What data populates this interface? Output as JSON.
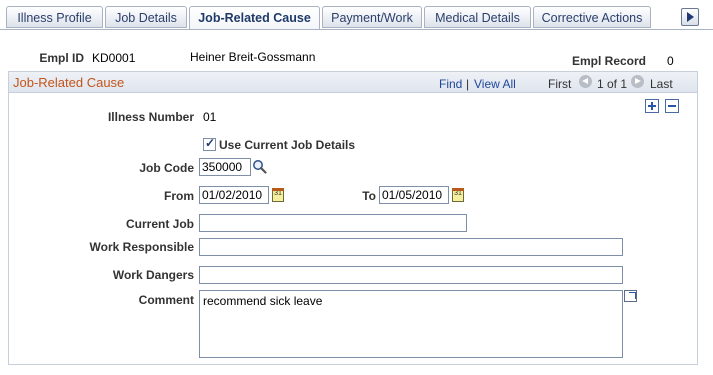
{
  "tabs": [
    {
      "label": "Illness Profile"
    },
    {
      "label": "Job Details"
    },
    {
      "label": "Job-Related Cause"
    },
    {
      "label": "Payment/Work"
    },
    {
      "label": "Medical Details"
    },
    {
      "label": "Corrective Actions"
    }
  ],
  "active_tab": "Job-Related Cause",
  "header": {
    "empl_id_label": "Empl ID",
    "empl_id": "KD0001",
    "empl_name": "Heiner Breit-Gossmann",
    "empl_record_label": "Empl Record",
    "empl_record": "0"
  },
  "grid": {
    "title": "Job-Related Cause",
    "find": "Find",
    "separator": "|",
    "view_all": "View All",
    "first": "First",
    "page_info": "1 of 1",
    "last": "Last"
  },
  "form": {
    "illness_number_label": "Illness Number",
    "illness_number": "01",
    "use_current_label": "Use Current Job Details",
    "use_current_checked": true,
    "job_code_label": "Job Code",
    "job_code": "350000",
    "from_label": "From",
    "from_date": "01/02/2010",
    "to_label": "To",
    "to_date": "01/05/2010",
    "current_job_label": "Current Job",
    "current_job": "",
    "work_responsible_label": "Work Responsible",
    "work_responsible": "",
    "work_dangers_label": "Work Dangers",
    "work_dangers": "",
    "comment_label": "Comment",
    "comment": "recommend sick leave"
  },
  "icons": {
    "lookup": "magnifier-icon",
    "calendar": "calendar-icon",
    "add_row": "plus-icon",
    "delete_row": "minus-icon",
    "expand": "expand-icon",
    "tab_scroll": "arrow-right-icon"
  },
  "colors": {
    "grid_title": "#c3541b",
    "link": "#21479c",
    "tab_text": "#2b3f6b"
  }
}
